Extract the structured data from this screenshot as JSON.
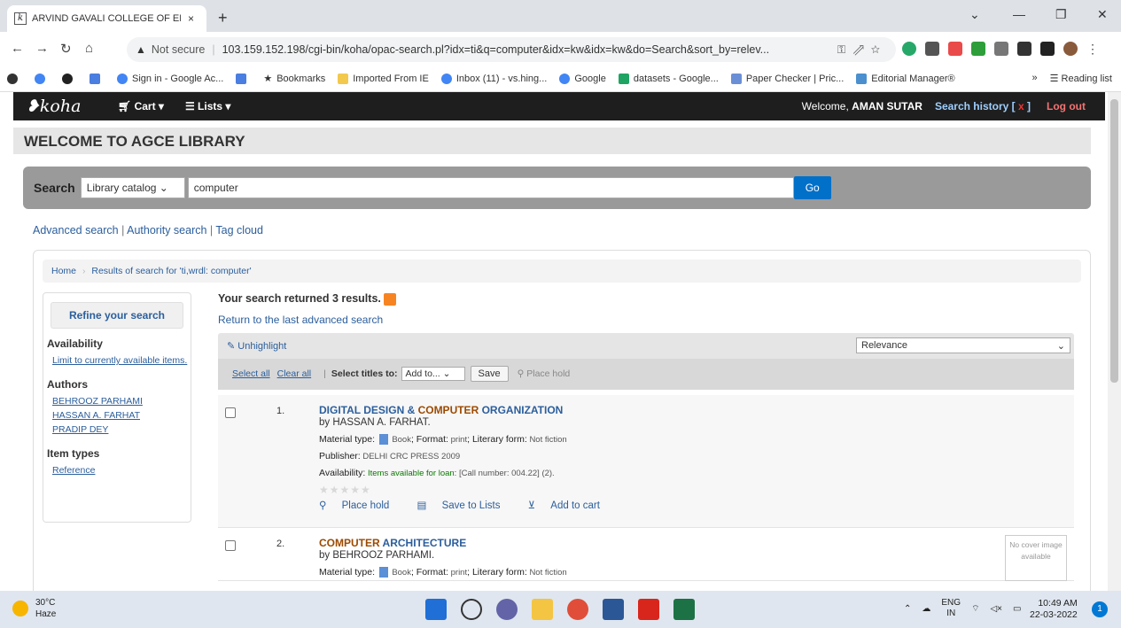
{
  "browser": {
    "tab_title": "ARVIND GAVALI COLLEGE OF EN",
    "tab_close": "×",
    "new_tab": "+",
    "address": {
      "security_label": "Not secure",
      "url": "103.159.152.198/cgi-bin/koha/opac-search.pl?idx=ti&q=computer&idx=kw&idx=kw&do=Search&sort_by=relev..."
    },
    "bookmarks": [
      "Sign in - Google Ac...",
      "Bookmarks",
      "Imported From IE",
      "Inbox (11) - vs.hing...",
      "Google",
      "datasets - Google...",
      "Paper Checker | Pric...",
      "Editorial Manager®"
    ],
    "bookmarks_more": "»",
    "reading_list": "Reading list"
  },
  "koha": {
    "logo": "koha",
    "cart": "Cart",
    "lists": "Lists",
    "welcome_prefix": "Welcome,",
    "user": "AMAN SUTAR",
    "search_history": "Search history [",
    "search_history_x": "x",
    "search_history_end": "]",
    "logout": "Log out",
    "library_title": "WELCOME TO AGCE LIBRARY",
    "search": {
      "label": "Search",
      "scope": "Library catalog",
      "query": "computer",
      "go": "Go"
    },
    "more_search": {
      "advanced": "Advanced search",
      "authority": "Authority search",
      "tag_cloud": "Tag cloud"
    },
    "breadcrumb": {
      "home": "Home",
      "current": "Results of search for 'ti,wrdl: computer'"
    },
    "facets": {
      "refine": "Refine your search",
      "availability_h": "Availability",
      "availability_link": "Limit to currently available items.",
      "authors_h": "Authors",
      "authors": [
        "BEHROOZ PARHAMI",
        "HASSAN A. FARHAT",
        "PRADIP DEY"
      ],
      "itemtypes_h": "Item types",
      "itemtypes": [
        "Reference"
      ]
    },
    "results": {
      "count_text": "Your search returned 3 results.",
      "return_link": "Return to the last advanced search",
      "unhighlight": "Unhighlight",
      "sort": "Relevance",
      "select_all": "Select all",
      "clear_all": "Clear all",
      "select_titles": "Select titles to:",
      "add_to": "Add to...",
      "save": "Save",
      "place_hold": "Place hold"
    },
    "records": [
      {
        "num": "1.",
        "title_a": "DIGITAL DESIGN & ",
        "title_hl": "COMPUTER",
        "title_b": " ORGANIZATION",
        "by": "by HASSAN A. FARHAT.",
        "material_label": "Material type:",
        "material": "Book",
        "format_label": "; Format:",
        "format": "print",
        "lit_label": "; Literary form:",
        "lit": "Not fiction",
        "publisher_label": "Publisher:",
        "publisher": "DELHI CRC PRESS 2009",
        "avail_label": "Availability:",
        "avail_ok": "Items available for loan:",
        "avail_rest": "[Call number: 004.22] (2).",
        "stars": "★★★★★",
        "place_hold": "Place hold",
        "save_lists": "Save to Lists",
        "add_cart": "Add to cart"
      },
      {
        "num": "2.",
        "title_hl": "COMPUTER",
        "title_b": " ARCHITECTURE",
        "by": "by BEHROOZ PARHAMI.",
        "material_partial": "Material type:",
        "material": "Book",
        "format_label": "; Format:",
        "format": "print",
        "lit_label": "; Literary form:",
        "lit": "Not fiction",
        "no_cover": "No cover image available"
      }
    ]
  },
  "taskbar": {
    "temp": "30°C",
    "weather": "Haze",
    "lang": "ENG",
    "region": "IN",
    "time": "10:49 AM",
    "date": "22-03-2022",
    "notif": "1"
  }
}
